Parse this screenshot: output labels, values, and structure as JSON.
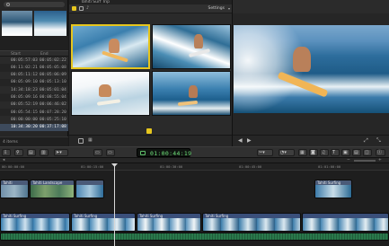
{
  "app": {
    "project_title": "Tahiti Surf Trip"
  },
  "library": {
    "columns": [
      "Start",
      "End"
    ],
    "rows": [
      {
        "start": "00:05:57:03",
        "end": "00:05:02:22"
      },
      {
        "start": "00:11:02:21",
        "end": "00:05:05:08"
      },
      {
        "start": "00:05:11:12",
        "end": "00:05:06:09"
      },
      {
        "start": "00:05:09:10",
        "end": "00:05:13:10"
      },
      {
        "start": "14:34:18:23",
        "end": "00:05:01:04"
      },
      {
        "start": "00:05:09:16",
        "end": "00:08:55:04"
      },
      {
        "start": "00:05:52:19",
        "end": "00:06:46:02"
      },
      {
        "start": "00:05:54:15",
        "end": "00:07:28:20"
      },
      {
        "start": "00:00:00:00",
        "end": "00:05:25:10"
      },
      {
        "start": "10:34:30:20",
        "end": "00:37:17:08"
      }
    ],
    "selected_row": 9,
    "footer": "4 items"
  },
  "angle_viewer": {
    "settings_label": "Settings",
    "active_angle": 1
  },
  "toolbar": {
    "timecode": "01:00:44:19",
    "buttons": [
      "import-icon",
      "keyword-icon",
      "analyze-icon",
      "share-icon",
      "select-tool-icon",
      "append-icon",
      "insert-icon",
      "overwrite-icon",
      "connect-icon"
    ]
  },
  "timeline": {
    "ruler_ticks": [
      "00:00:00:00",
      "01:00:15:00",
      "01:00:30:00",
      "01:00:45:00",
      "01:01:00:00",
      "01:01:15:00"
    ],
    "clips": {
      "connected": [
        {
          "label": "Tahiti"
        },
        {
          "label": "Tahiti Landscape"
        },
        {
          "label": ""
        },
        {
          "label": "Tahiti Surfing"
        }
      ],
      "storyline": [
        {
          "label": "Tahiti Surfing"
        },
        {
          "label": "Tahiti Surfing"
        },
        {
          "label": "Tahiti Surfing"
        },
        {
          "label": "Tahiti Surfing"
        }
      ]
    }
  },
  "colors": {
    "accent_yellow": "#e6c61e",
    "timecode_green": "#6fe07a",
    "background": "#1a1a1a"
  }
}
